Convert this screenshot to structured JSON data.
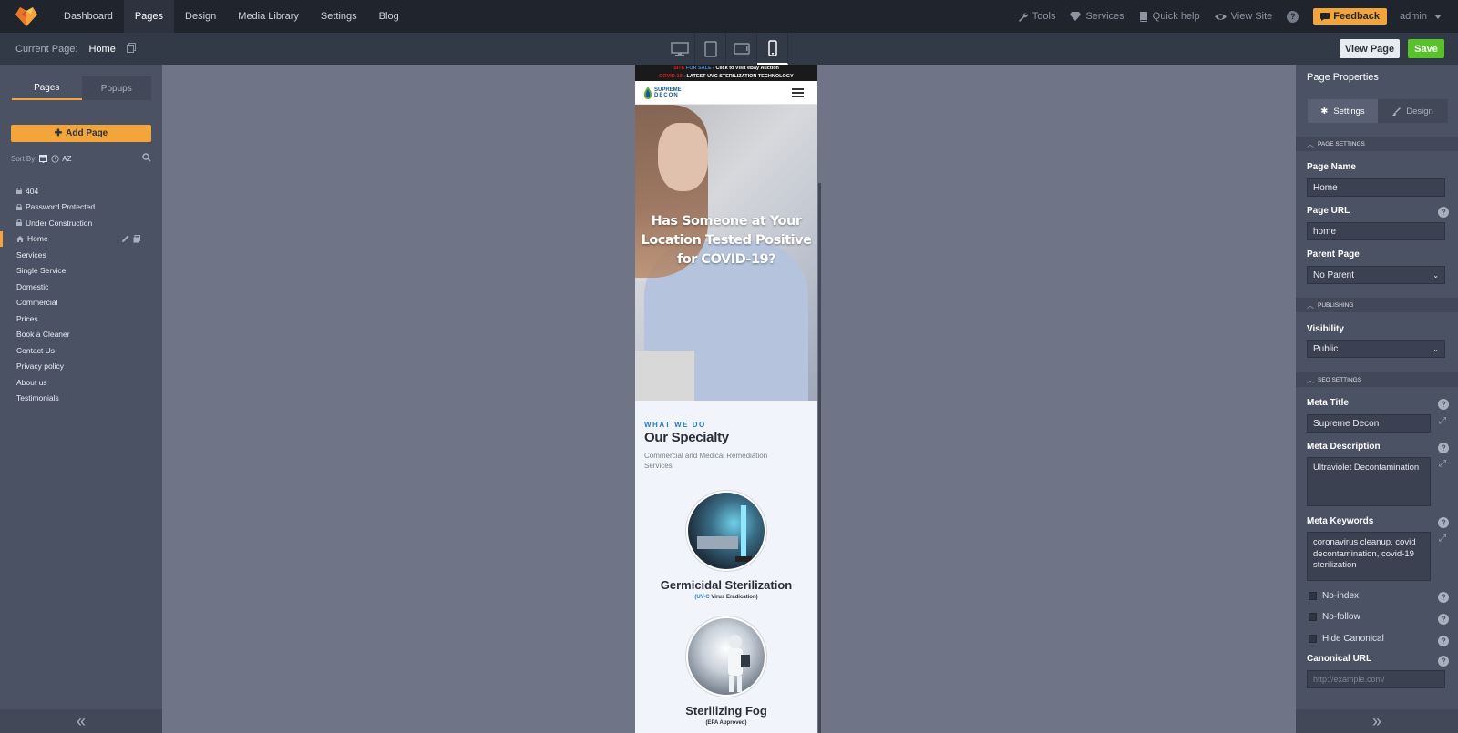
{
  "topnav": {
    "items": [
      "Dashboard",
      "Pages",
      "Design",
      "Media Library",
      "Settings",
      "Blog"
    ],
    "active_index": 1,
    "right": {
      "tools": "Tools",
      "services": "Services",
      "quick_help": "Quick help",
      "view_site": "View Site",
      "help": "?",
      "feedback": "Feedback",
      "user": "admin"
    }
  },
  "subbar": {
    "current_label": "Current Page:",
    "current_name": "Home",
    "view_page": "View Page",
    "save": "Save",
    "active_device": "mobile"
  },
  "left": {
    "tabs": [
      "Pages",
      "Popups"
    ],
    "add_page": "Add Page",
    "sort_by": "Sort By",
    "sort_az": "AZ",
    "pages": [
      {
        "label": "404",
        "locked": true
      },
      {
        "label": "Password Protected",
        "locked": true
      },
      {
        "label": "Under Construction",
        "locked": true
      },
      {
        "label": "Home",
        "home": true,
        "active": true
      },
      {
        "label": "Services"
      },
      {
        "label": "Single Service"
      },
      {
        "label": "Domestic"
      },
      {
        "label": "Commercial"
      },
      {
        "label": "Prices"
      },
      {
        "label": "Book a Cleaner"
      },
      {
        "label": "Contact Us"
      },
      {
        "label": "Privacy policy"
      },
      {
        "label": "About us"
      },
      {
        "label": "Testimonials"
      }
    ]
  },
  "preview": {
    "banner1_a": "SITE",
    "banner1_b": "FOR SALE",
    "banner1_c": " - Click to Visit eBay Auction",
    "banner2_a": "COVID-19",
    "banner2_b": " - LATEST UVC STERILIZATION TECHNOLOGY",
    "logo_line1": "SUPREME",
    "logo_line2": "DECON",
    "hero_title": "Has Someone at Your Location Tested Positive for COVID-19?",
    "what_we_do": "WHAT WE DO",
    "specialty": "Our Specialty",
    "specialty_sub": "Commercial and Medical Remediation Services",
    "service1_title": "Germicidal Sterilization",
    "service1_sub_blue": "(UV-C",
    "service1_sub_rest": " Virus Eradication)",
    "service2_title": "Sterilizing Fog",
    "service2_sub": "(EPA Approved)"
  },
  "right": {
    "title": "Page Properties",
    "tabs": [
      "Settings",
      "Design"
    ],
    "sections": {
      "page_settings": "PAGE SETTINGS",
      "publishing": "PUBLISHING",
      "seo": "SEO SETTINGS"
    },
    "page_name_label": "Page Name",
    "page_name": "Home",
    "page_url_label": "Page URL",
    "page_url": "home",
    "parent_label": "Parent Page",
    "parent_value": "No Parent",
    "visibility_label": "Visibility",
    "visibility_value": "Public",
    "meta_title_label": "Meta Title",
    "meta_title": "Supreme Decon",
    "meta_desc_label": "Meta Description",
    "meta_desc": "Ultraviolet Decontamination",
    "meta_keywords_label": "Meta Keywords",
    "meta_keywords": "coronavirus cleanup, covid decontamination, covid-19 sterilization",
    "no_index": "No-index",
    "no_follow": "No-follow",
    "hide_canonical": "Hide Canonical",
    "canonical_label": "Canonical URL",
    "canonical_placeholder": "http://example.com/"
  },
  "colors": {
    "accent": "#f2a53a",
    "save": "#58c22b",
    "nav_bg": "#1f242d",
    "panel_bg": "#4b5264",
    "canvas_bg": "#6f7587",
    "link_blue": "#2c7bc3"
  }
}
